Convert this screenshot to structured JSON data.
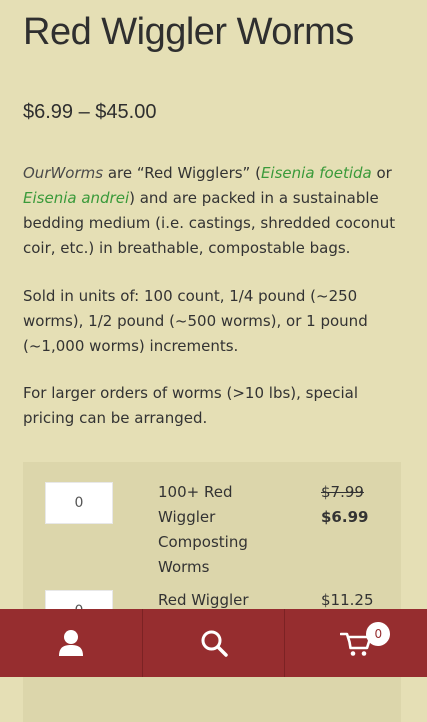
{
  "product": {
    "title": "Red Wiggler Worms",
    "price_range": "$6.99 – $45.00"
  },
  "description": {
    "p1_brand": "OurWorms",
    "p1_text_a": " are “Red Wigglers” (",
    "p1_link1": "Eisenia foetida",
    "p1_or": " or ",
    "p1_link2": "Eisenia andrei",
    "p1_text_b": ") and are packed in a sustainable bedding medium (i.e. castings, shredded coconut coir, etc.) in breathable, compostable bags.",
    "p2": "Sold in units of: 100 count, 1/4 pound (~250 worms), 1/2 pound (~500 worms), or 1 pound (~1,000 worms) increments.",
    "p3": "For larger orders of worms (>10 lbs), special pricing  can be arranged."
  },
  "variants": [
    {
      "quantity": "0",
      "name": "100+ Red Wiggler Composting Worms",
      "old_price": "$7.99",
      "price": "$6.99"
    },
    {
      "quantity": "0",
      "name": "Red Wiggler",
      "price": "$11.25"
    }
  ],
  "footer": {
    "account_icon": "user-icon",
    "search_icon": "search-icon",
    "cart_icon": "cart-icon",
    "cart_count": "0",
    "background": "#962d2f"
  }
}
